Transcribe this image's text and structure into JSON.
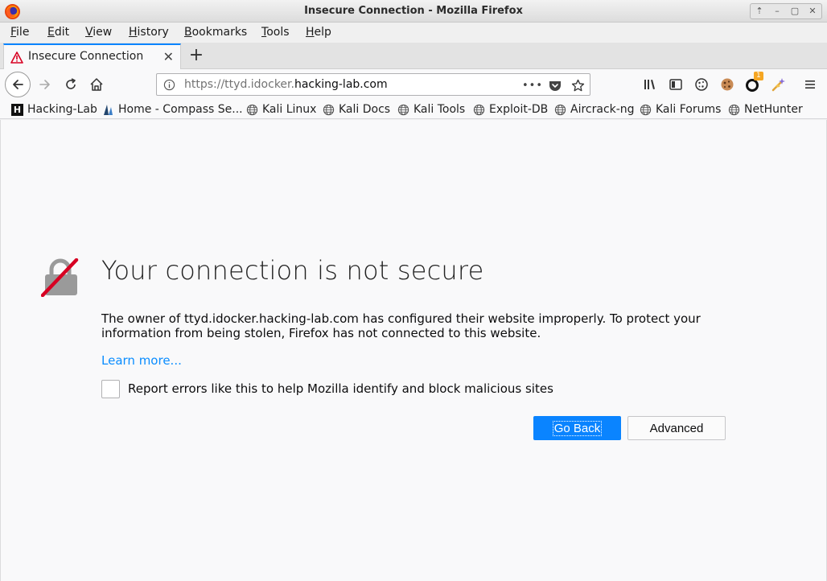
{
  "window": {
    "title": "Insecure Connection - Mozilla Firefox",
    "controls": [
      "⇡",
      "–",
      "▢",
      "✕"
    ]
  },
  "menu": {
    "file": "File",
    "edit": "Edit",
    "view": "View",
    "history": "History",
    "bookmarks": "Bookmarks",
    "tools": "Tools",
    "help": "Help"
  },
  "tab": {
    "label": "Insecure Connection",
    "close": "✕",
    "new_tab": "+"
  },
  "urlbar": {
    "url_prefix": "https://ttyd.idocker.",
    "url_host": "hacking-lab.com",
    "page_actions": "•••"
  },
  "toolbar": {
    "badge": "1"
  },
  "bookmarks": [
    {
      "label": "Hacking-Lab",
      "icon": "hackinglab-icon"
    },
    {
      "label": "Home - Compass Se...",
      "icon": "compass-icon"
    },
    {
      "label": "Kali Linux",
      "icon": "globe-icon"
    },
    {
      "label": "Kali Docs",
      "icon": "globe-icon"
    },
    {
      "label": "Kali Tools",
      "icon": "globe-icon"
    },
    {
      "label": "Exploit-DB",
      "icon": "globe-icon"
    },
    {
      "label": "Aircrack-ng",
      "icon": "globe-icon"
    },
    {
      "label": "Kali Forums",
      "icon": "globe-icon"
    },
    {
      "label": "NetHunter",
      "icon": "globe-icon"
    }
  ],
  "error": {
    "title": "Your connection is not secure",
    "description": "The owner of ttyd.idocker.hacking-lab.com has configured their website improperly. To protect your information from being stolen, Firefox has not connected to this website.",
    "learn_more": "Learn more...",
    "report_label": "Report errors like this to help Mozilla identify and block malicious sites",
    "report_checked": false,
    "go_back": "Go Back",
    "advanced": "Advanced"
  },
  "colors": {
    "accent": "#0a84ff",
    "link": "#0a8dff",
    "lock_strike": "#d70022"
  }
}
